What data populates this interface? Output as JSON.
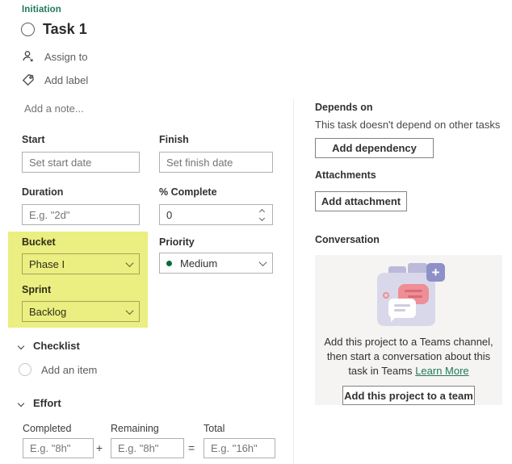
{
  "header": {
    "phase_label": "Initiation",
    "task_title": "Task 1",
    "assign_to": "Assign to",
    "add_label": "Add label",
    "note_placeholder": "Add a note..."
  },
  "fields": {
    "start": {
      "label": "Start",
      "placeholder": "Set start date"
    },
    "finish": {
      "label": "Finish",
      "placeholder": "Set finish date"
    },
    "duration": {
      "label": "Duration",
      "placeholder": "E.g. \"2d\""
    },
    "percent_complete": {
      "label": "% Complete",
      "value": "0"
    },
    "bucket": {
      "label": "Bucket",
      "value": "Phase I"
    },
    "priority": {
      "label": "Priority",
      "value": "Medium"
    },
    "sprint": {
      "label": "Sprint",
      "value": "Backlog"
    }
  },
  "checklist": {
    "title": "Checklist",
    "add_item": "Add an item"
  },
  "effort": {
    "title": "Effort",
    "completed_label": "Completed",
    "remaining_label": "Remaining",
    "total_label": "Total",
    "completed_placeholder": "E.g. \"8h\"",
    "remaining_placeholder": "E.g. \"8h\"",
    "total_placeholder": "E.g. \"16h\"",
    "plus": "+",
    "equals": "="
  },
  "right": {
    "depends_on": {
      "title": "Depends on",
      "empty_text": "This task doesn't depend on other tasks",
      "button": "Add dependency"
    },
    "attachments": {
      "title": "Attachments",
      "button": "Add attachment"
    },
    "conversation": {
      "title": "Conversation",
      "description": "Add this project to a Teams channel, then start a conversation about this task in Teams",
      "learn_more": "Learn More",
      "button": "Add this project to a team"
    }
  },
  "colors": {
    "accent_green": "#217a57",
    "highlight_yellow": "#e3e84e",
    "priority_dot_green": "#0e6a3a",
    "panel_gray": "#f5f4f2"
  }
}
